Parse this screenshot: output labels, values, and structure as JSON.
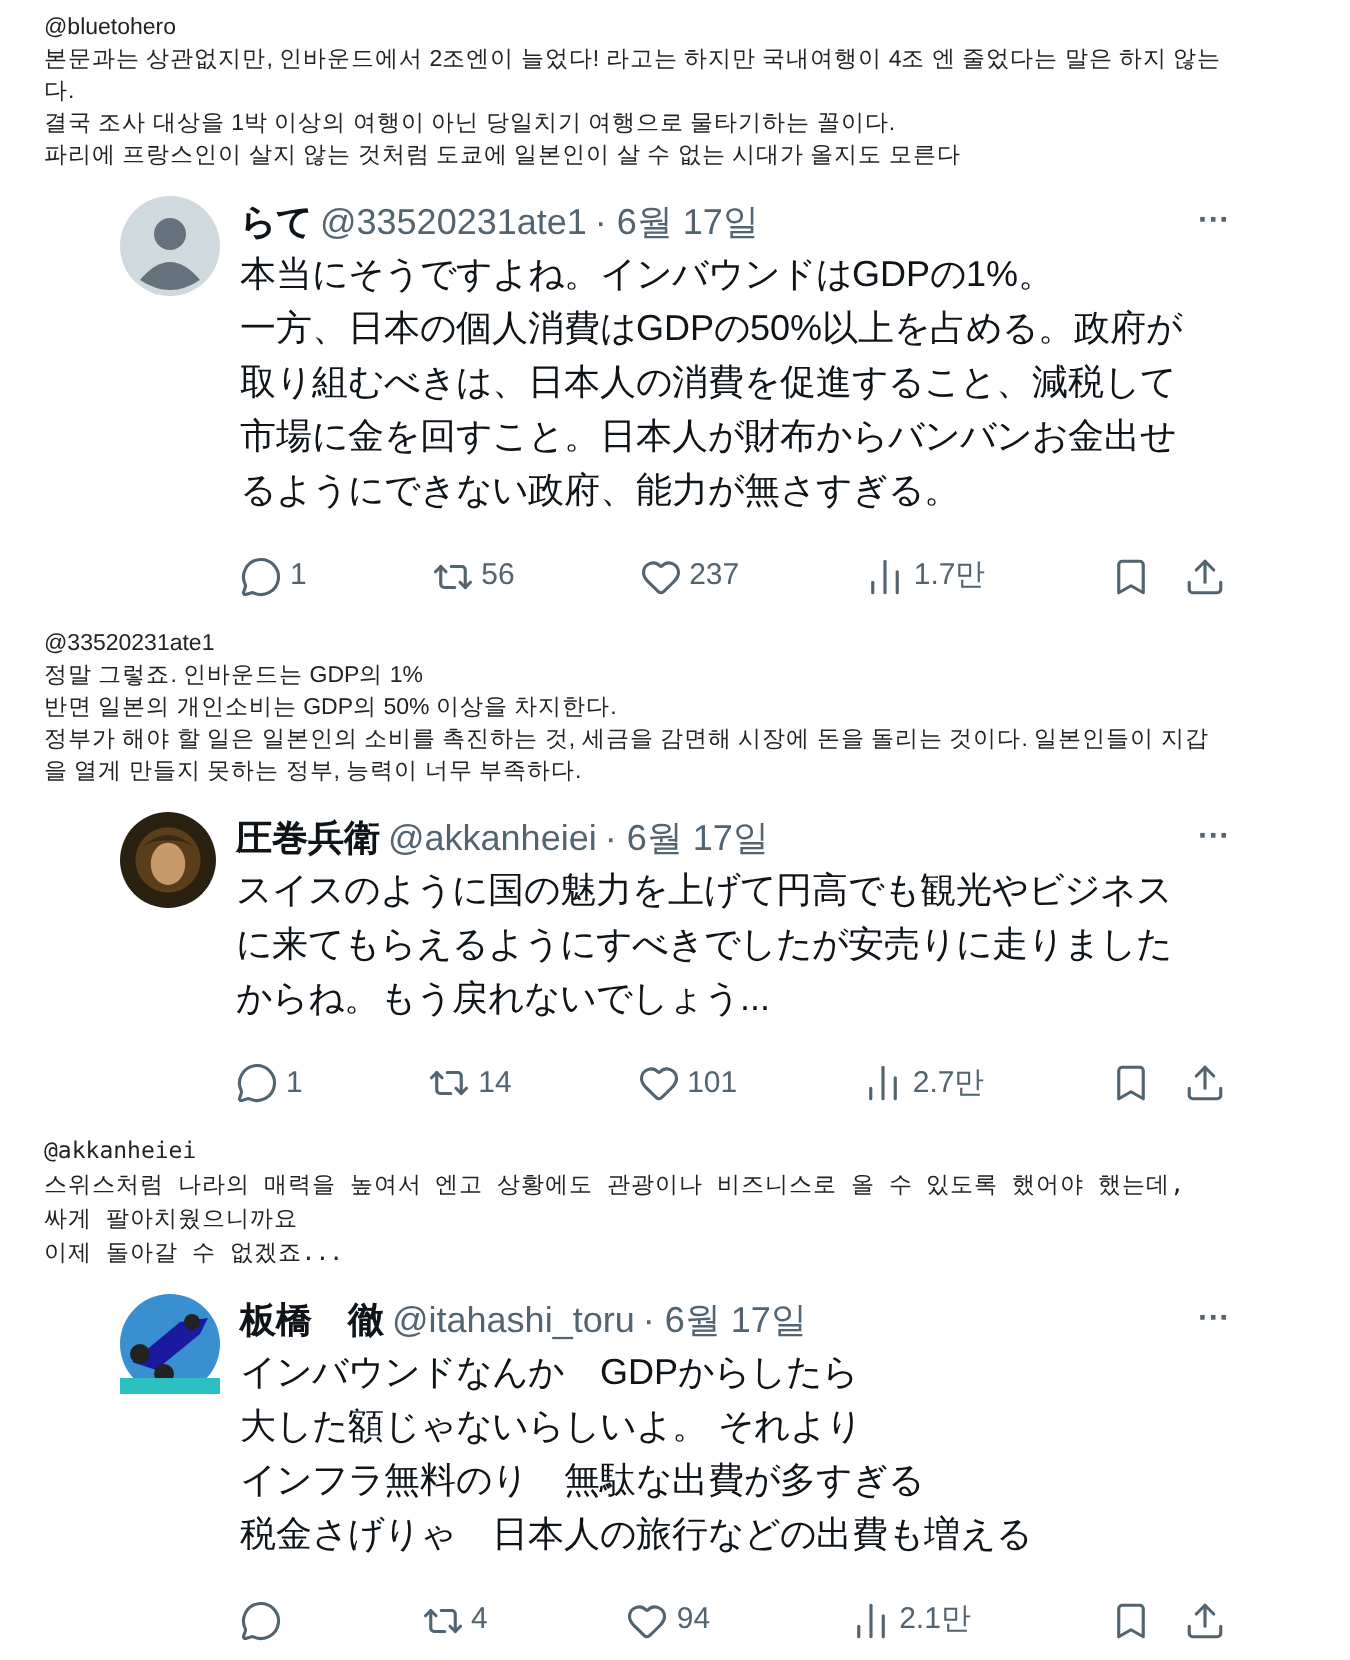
{
  "posts": [
    {
      "kind": "translation",
      "mono": false,
      "handle": "@bluetohero",
      "paragraphs": [
        "본문과는 상관없지만, 인바운드에서 2조엔이 늘었다! 라고는 하지만 국내여행이 4조 엔 줄었다는 말은 하지 않는다.",
        "결국 조사 대상을 1박 이상의 여행이 아닌 당일치기 여행으로 물타기하는 꼴이다.",
        "파리에 프랑스인이 살지 않는 것처럼 도쿄에 일본인이 살 수 없는 시대가 올지도 모른다"
      ]
    },
    {
      "kind": "tweet",
      "name": "らて",
      "handle": "@33520231ate1",
      "date": "· 6월 17일",
      "more": "···",
      "lines": [
        "本当にそうですよね。インバウンドはGDPの1%。",
        "一方、日本の個人消費はGDPの50%以上を占める。政府が",
        "取り組むべきは、日本人の消費を促進すること、減税して",
        "市場に金を回すこと。日本人が財布からバンバンお金出せ",
        "るようにできない政府、能力が無さすぎる。"
      ],
      "replies": "1",
      "reposts": "56",
      "likes": "237",
      "views": "1.7만"
    },
    {
      "kind": "translation",
      "mono": false,
      "handle": "@33520231ate1",
      "paragraphs": [
        "정말 그렇죠. 인바운드는 GDP의 1%",
        "반면 일본의 개인소비는 GDP의 50% 이상을 차지한다.",
        "정부가 해야 할 일은 일본인의 소비를 촉진하는 것, 세금을 감면해 시장에 돈을 돌리는 것이다. 일본인들이 지갑을 열게 만들지 못하는 정부, 능력이 너무 부족하다."
      ]
    },
    {
      "kind": "tweet",
      "name": "圧巻兵衛",
      "handle": "@akkanheiei",
      "date": "· 6월 17일",
      "more": "···",
      "lines": [
        "スイスのように国の魅力を上げて円高でも観光やビジネス",
        "に来てもらえるようにすべきでしたが安売りに走りました",
        "からね。もう戻れないでしょう..."
      ],
      "replies": "1",
      "reposts": "14",
      "likes": "101",
      "views": "2.7만"
    },
    {
      "kind": "translation",
      "mono": true,
      "handle": "@akkanheiei",
      "paragraphs": [
        "스위스처럼 나라의 매력을 높여서 엔고 상황에도 관광이나 비즈니스로 올 수 있도록 했어야 했는데,",
        "싸게 팔아치웠으니까요",
        "이제 돌아갈 수 없겠죠..."
      ]
    },
    {
      "kind": "tweet",
      "name": "板橋　徹",
      "handle": "@itahashi_toru",
      "date": "· 6월 17일",
      "more": "···",
      "lines": [
        "インバウンドなんか　GDPからしたら",
        "大した額じゃないらしいよ。 それより",
        "インフラ無料のり　無駄な出費が多すぎる",
        "税金さげりゃ　日本人の旅行などの出費も増える"
      ],
      "reposts": "4",
      "likes": "94",
      "views": "2.1만"
    }
  ]
}
